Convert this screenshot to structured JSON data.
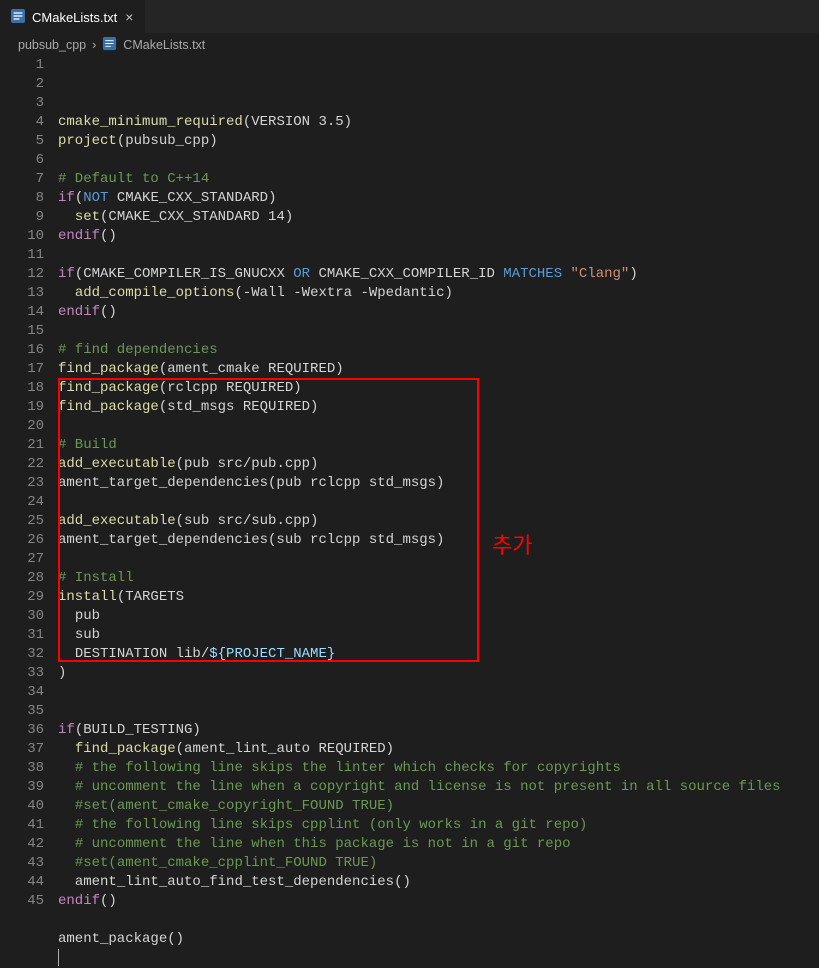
{
  "tab": {
    "filename": "CMakeLists.txt"
  },
  "breadcrumb": {
    "folder": "pubsub_cpp",
    "file": "CMakeLists.txt"
  },
  "annotation": "추가",
  "code": {
    "lines": [
      [
        {
          "c": "tok-func",
          "t": "cmake_minimum_required"
        },
        {
          "c": "tok-paren",
          "t": "(VERSION 3.5)"
        }
      ],
      [
        {
          "c": "tok-func",
          "t": "project"
        },
        {
          "c": "tok-paren",
          "t": "(pubsub_cpp)"
        }
      ],
      [],
      [
        {
          "c": "tok-comment",
          "t": "# Default to C++14"
        }
      ],
      [
        {
          "c": "tok-ctrl",
          "t": "if"
        },
        {
          "c": "tok-paren",
          "t": "("
        },
        {
          "c": "tok-keyword",
          "t": "NOT"
        },
        {
          "c": "tok-paren",
          "t": " CMAKE_CXX_STANDARD)"
        }
      ],
      [
        {
          "c": "indent-guide",
          "t": "  "
        },
        {
          "c": "tok-func",
          "t": "set"
        },
        {
          "c": "tok-paren",
          "t": "(CMAKE_CXX_STANDARD 14)"
        }
      ],
      [
        {
          "c": "tok-ctrl",
          "t": "endif"
        },
        {
          "c": "tok-paren",
          "t": "()"
        }
      ],
      [],
      [
        {
          "c": "tok-ctrl",
          "t": "if"
        },
        {
          "c": "tok-paren",
          "t": "(CMAKE_COMPILER_IS_GNUCXX "
        },
        {
          "c": "tok-keyword",
          "t": "OR"
        },
        {
          "c": "tok-paren",
          "t": " CMAKE_CXX_COMPILER_ID "
        },
        {
          "c": "tok-keyword",
          "t": "MATCHES"
        },
        {
          "c": "tok-paren",
          "t": " "
        },
        {
          "c": "tok-string",
          "t": "\"Clang\""
        },
        {
          "c": "tok-paren",
          "t": ")"
        }
      ],
      [
        {
          "c": "indent-guide",
          "t": "  "
        },
        {
          "c": "tok-func",
          "t": "add_compile_options"
        },
        {
          "c": "tok-paren",
          "t": "(-Wall -Wextra -Wpedantic)"
        }
      ],
      [
        {
          "c": "tok-ctrl",
          "t": "endif"
        },
        {
          "c": "tok-paren",
          "t": "()"
        }
      ],
      [],
      [
        {
          "c": "tok-comment",
          "t": "# find dependencies"
        }
      ],
      [
        {
          "c": "tok-func",
          "t": "find_package"
        },
        {
          "c": "tok-paren",
          "t": "(ament_cmake REQUIRED)"
        }
      ],
      [
        {
          "c": "tok-func",
          "t": "find_package"
        },
        {
          "c": "tok-paren",
          "t": "(rclcpp REQUIRED)"
        }
      ],
      [
        {
          "c": "tok-func",
          "t": "find_package"
        },
        {
          "c": "tok-paren",
          "t": "(std_msgs REQUIRED)"
        }
      ],
      [],
      [
        {
          "c": "tok-comment",
          "t": "# Build"
        }
      ],
      [
        {
          "c": "tok-func",
          "t": "add_executable"
        },
        {
          "c": "tok-paren",
          "t": "(pub src/pub.cpp)"
        }
      ],
      [
        {
          "c": "tok-plain",
          "t": "ament_target_dependencies(pub rclcpp std_msgs)"
        }
      ],
      [],
      [
        {
          "c": "tok-func",
          "t": "add_executable"
        },
        {
          "c": "tok-paren",
          "t": "(sub src/sub.cpp)"
        }
      ],
      [
        {
          "c": "tok-plain",
          "t": "ament_target_dependencies(sub rclcpp std_msgs)"
        }
      ],
      [],
      [
        {
          "c": "tok-comment",
          "t": "# Install"
        }
      ],
      [
        {
          "c": "tok-func",
          "t": "install"
        },
        {
          "c": "tok-paren",
          "t": "(TARGETS"
        }
      ],
      [
        {
          "c": "indent-guide",
          "t": "  "
        },
        {
          "c": "tok-plain",
          "t": "pub"
        }
      ],
      [
        {
          "c": "indent-guide",
          "t": "  "
        },
        {
          "c": "tok-plain",
          "t": "sub"
        }
      ],
      [
        {
          "c": "indent-guide",
          "t": "  "
        },
        {
          "c": "tok-plain",
          "t": "DESTINATION lib/"
        },
        {
          "c": "tok-var",
          "t": "${PROJECT_NAME}"
        }
      ],
      [
        {
          "c": "tok-paren",
          "t": ")"
        }
      ],
      [],
      [],
      [
        {
          "c": "tok-ctrl",
          "t": "if"
        },
        {
          "c": "tok-paren",
          "t": "(BUILD_TESTING)"
        }
      ],
      [
        {
          "c": "indent-guide",
          "t": "  "
        },
        {
          "c": "tok-func",
          "t": "find_package"
        },
        {
          "c": "tok-paren",
          "t": "(ament_lint_auto REQUIRED)"
        }
      ],
      [
        {
          "c": "indent-guide",
          "t": "  "
        },
        {
          "c": "tok-comment",
          "t": "# the following line skips the linter which checks for copyrights"
        }
      ],
      [
        {
          "c": "indent-guide",
          "t": "  "
        },
        {
          "c": "tok-comment",
          "t": "# uncomment the line when a copyright and license is not present in all source files"
        }
      ],
      [
        {
          "c": "indent-guide",
          "t": "  "
        },
        {
          "c": "tok-comment",
          "t": "#set(ament_cmake_copyright_FOUND TRUE)"
        }
      ],
      [
        {
          "c": "indent-guide",
          "t": "  "
        },
        {
          "c": "tok-comment",
          "t": "# the following line skips cpplint (only works in a git repo)"
        }
      ],
      [
        {
          "c": "indent-guide",
          "t": "  "
        },
        {
          "c": "tok-comment",
          "t": "# uncomment the line when this package is not in a git repo"
        }
      ],
      [
        {
          "c": "indent-guide",
          "t": "  "
        },
        {
          "c": "tok-comment",
          "t": "#set(ament_cmake_cpplint_FOUND TRUE)"
        }
      ],
      [
        {
          "c": "indent-guide",
          "t": "  "
        },
        {
          "c": "tok-plain",
          "t": "ament_lint_auto_find_test_dependencies()"
        }
      ],
      [
        {
          "c": "tok-ctrl",
          "t": "endif"
        },
        {
          "c": "tok-paren",
          "t": "()"
        }
      ],
      [],
      [
        {
          "c": "tok-plain",
          "t": "ament_package()"
        }
      ],
      []
    ]
  }
}
